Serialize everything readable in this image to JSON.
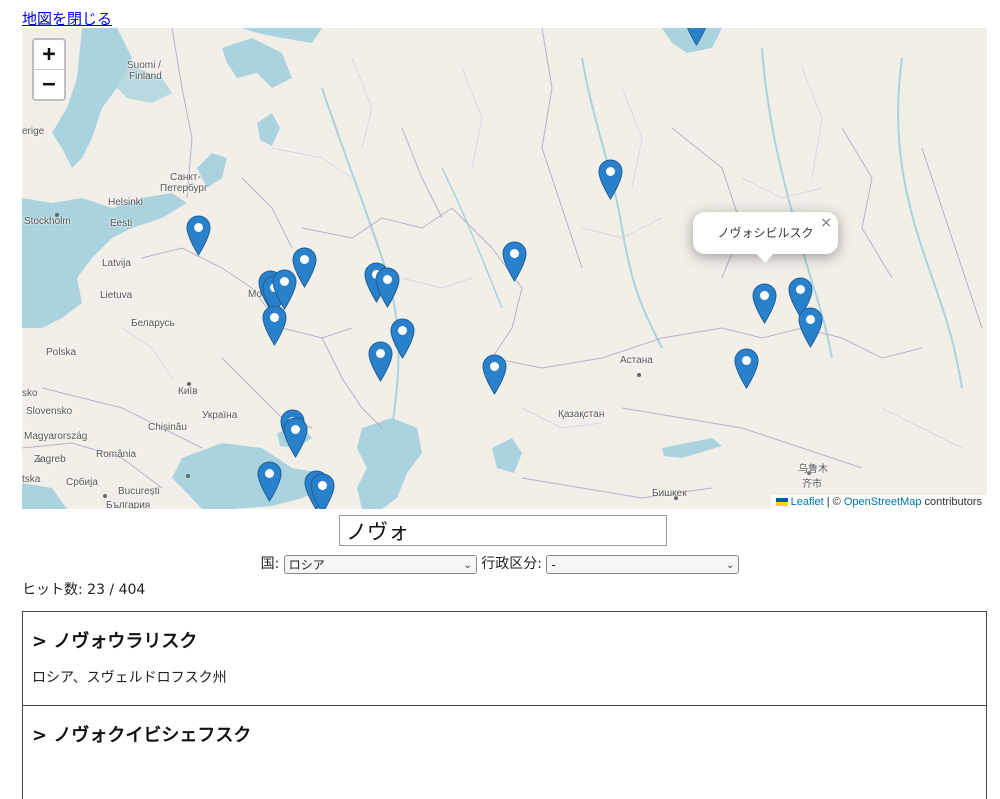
{
  "close_map_link": "地図を閉じる",
  "map": {
    "zoom_in": "+",
    "zoom_out": "−",
    "marker_color": "#2a81cb",
    "popup_text": "ノヴォシビルスク",
    "popup_close": "×",
    "labels": {
      "suomi": "Suomi /",
      "finland": "Finland",
      "sverige": "erige",
      "spb1": "Санкт-",
      "spb2": "Петербург",
      "helsinki": "Helsinki",
      "stockholm": "Stockholm",
      "eesti": "Eesti",
      "latvija": "Latvija",
      "lietuva": "Lietuva",
      "mo": "Mo",
      "belarus": "Беларусь",
      "polska": "Polska",
      "kyiv": "Київ",
      "sko": "sko",
      "slovensko": "Slovensko",
      "ukraina": "Україна",
      "chisinau": "Chișinău",
      "magyar": "Magyarország",
      "zagreb": "Zagreb",
      "romania": "România",
      "tska": "tska",
      "srbija": "Србија",
      "bucuresti": "București",
      "bulgaria": "България",
      "astana": "Астана",
      "kazakhstan": "Қазақстан",
      "bishkek": "Бишкек",
      "urumqi1": "乌鲁木",
      "urumqi2": "齐市"
    },
    "attribution": {
      "leaflet": "Leaflet",
      "separator": " | © ",
      "osm": "OpenStreetMap",
      "contributors": " contributors"
    }
  },
  "search": {
    "value": "ノヴォ"
  },
  "filters": {
    "country_label": "国:",
    "country_value": "ロシア",
    "admin_label": "行政区分:",
    "admin_value": "-"
  },
  "hits": "ヒット数: 23 / 404",
  "results": [
    {
      "title": "ノヴォウラリスク",
      "subtitle": "ロシア、スヴェルドロフスク州"
    },
    {
      "title": "ノヴォクイビシェフスク",
      "subtitle": ""
    }
  ]
}
